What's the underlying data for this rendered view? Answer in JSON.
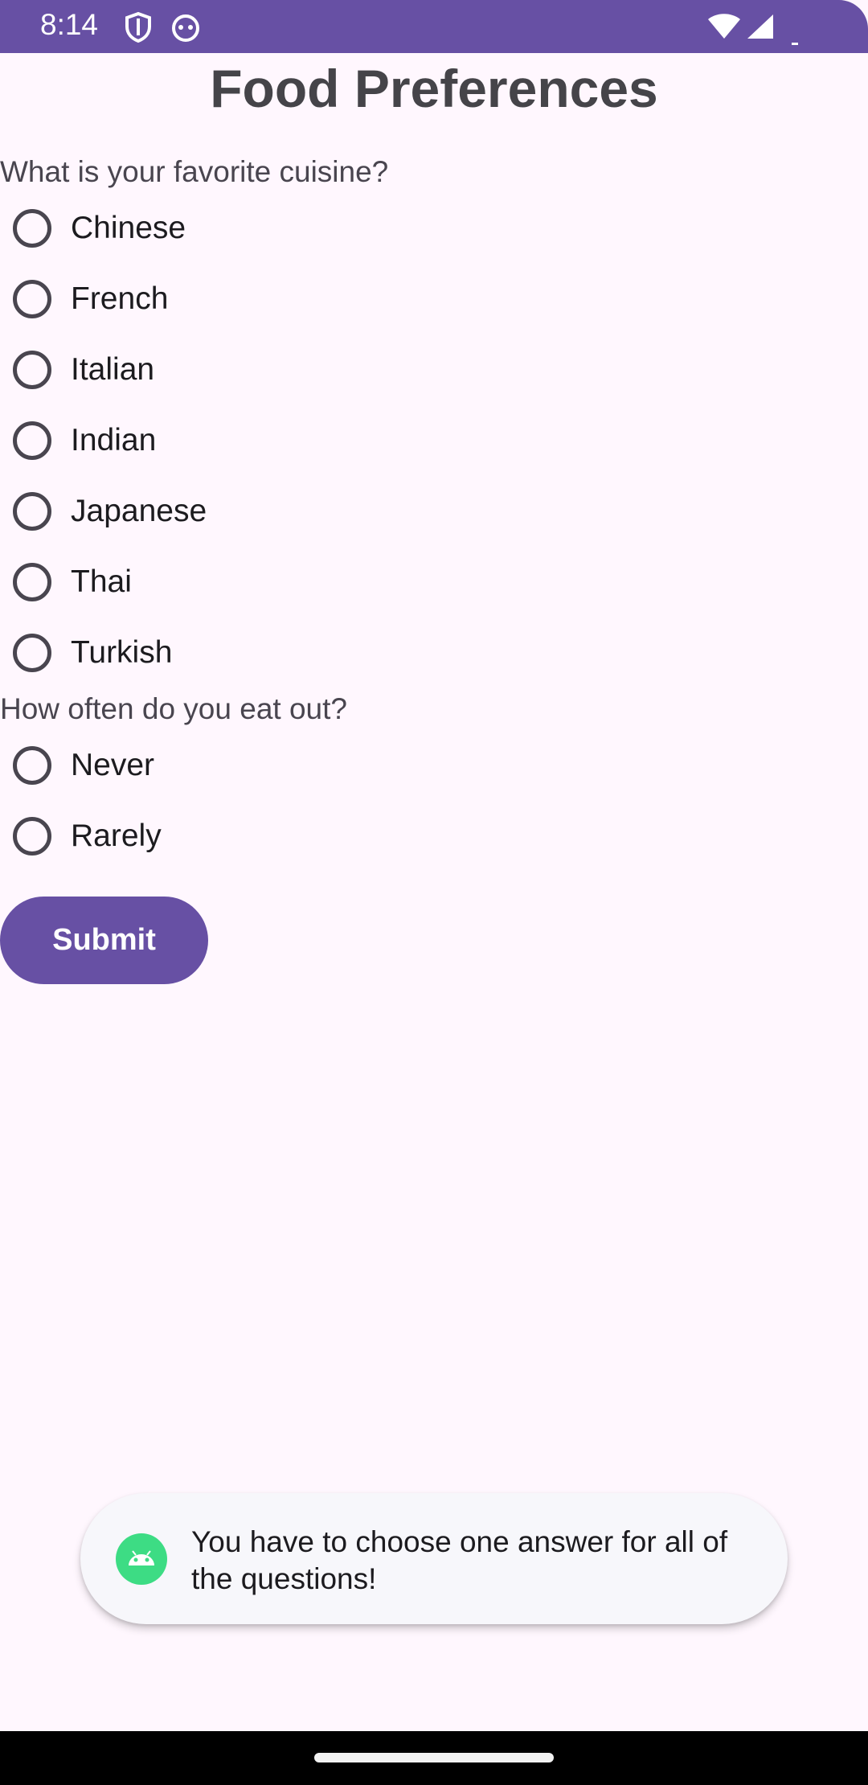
{
  "status_bar": {
    "time": "8:14",
    "icons": [
      "shield-icon",
      "android-face-icon",
      "wifi-icon",
      "signal-icon",
      "battery-icon"
    ],
    "color": "#6750A4"
  },
  "title": "Food Preferences",
  "questions": [
    {
      "text": "What is your favorite cuisine?",
      "options": [
        "Chinese",
        "French",
        "Italian",
        "Indian",
        "Japanese",
        "Thai",
        "Turkish"
      ]
    },
    {
      "text": "How often do you eat out?",
      "options": [
        "Never",
        "Rarely"
      ]
    }
  ],
  "submit_label": "Submit",
  "toast": {
    "message": "You have to choose one answer for all of the questions!",
    "icon": "android-icon"
  },
  "colors": {
    "accent": "#6750A4",
    "background": "#FFF7FE"
  }
}
